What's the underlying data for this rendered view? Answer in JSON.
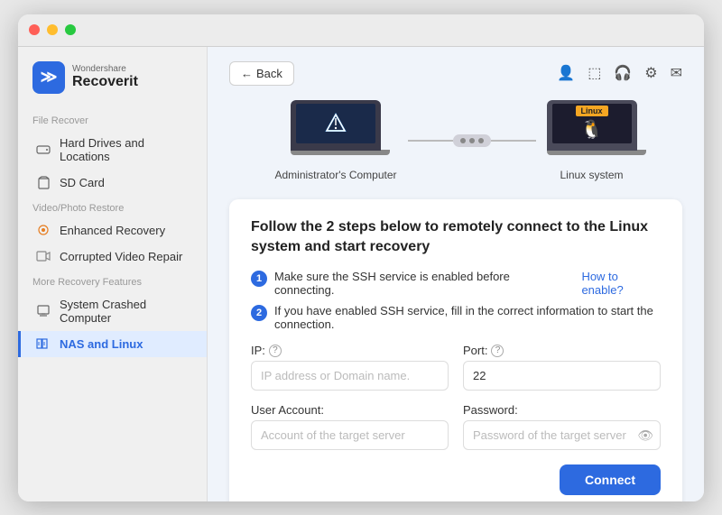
{
  "app": {
    "title_small": "Wondershare",
    "title_big": "Recoverit"
  },
  "sidebar": {
    "section1": "File Recover",
    "section2": "Video/Photo Restore",
    "section3": "More Recovery Features",
    "items": [
      {
        "id": "hard-drives",
        "label": "Hard Drives and Locations",
        "active": false
      },
      {
        "id": "sd-card",
        "label": "SD Card",
        "active": false
      },
      {
        "id": "enhanced-recovery",
        "label": "Enhanced Recovery",
        "active": false
      },
      {
        "id": "corrupted-video",
        "label": "Corrupted Video Repair",
        "active": false
      },
      {
        "id": "system-crashed",
        "label": "System Crashed Computer",
        "active": false
      },
      {
        "id": "nas-linux",
        "label": "NAS and Linux",
        "active": true
      }
    ]
  },
  "topbar": {
    "back_label": "Back"
  },
  "diagram": {
    "left_label": "Administrator's Computer",
    "right_label": "Linux system"
  },
  "form": {
    "title": "Follow the 2 steps below to remotely connect to the Linux system and start recovery",
    "step1": "Make sure the SSH service is enabled before connecting.",
    "step1_link": "How to enable?",
    "step2": "If you have enabled SSH service, fill in the correct information to start the connection.",
    "ip_label": "IP:",
    "ip_placeholder": "IP address or Domain name.",
    "port_label": "Port:",
    "port_value": "22",
    "user_label": "User Account:",
    "user_placeholder": "Account of the target server",
    "password_label": "Password:",
    "password_placeholder": "Password of the target server",
    "connect_label": "Connect"
  }
}
